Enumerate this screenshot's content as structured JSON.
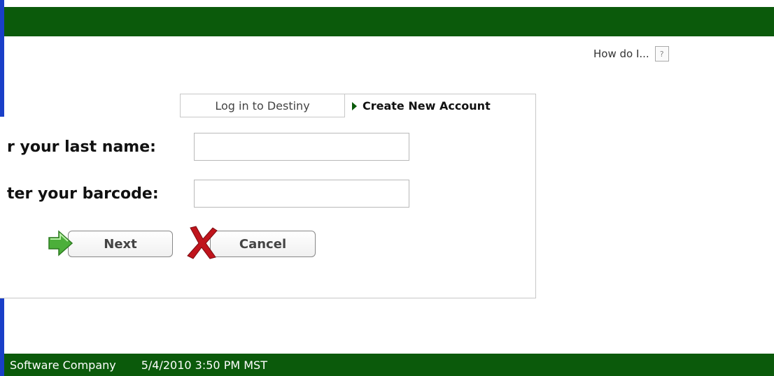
{
  "help": {
    "label": "How do I...",
    "icon_text": "?"
  },
  "tabs": [
    {
      "label": "Log in to Destiny",
      "active": false
    },
    {
      "label": "Create New Account",
      "active": true
    }
  ],
  "form": {
    "last_name_label": "r your last name:",
    "barcode_label": "ter your barcode:",
    "last_name_value": "",
    "barcode_value": ""
  },
  "buttons": {
    "next_label": "Next",
    "cancel_label": "Cancel"
  },
  "footer": {
    "company": "Software Company",
    "datetime": "5/4/2010 3:50 PM MST"
  },
  "colors": {
    "header_green": "#0b5a0b",
    "left_edge_blue": "#1a3fc8",
    "next_icon_green": "#4caf3a",
    "cancel_icon_red": "#c0141c"
  },
  "icons": {
    "help": "question-icon",
    "tab_active": "triangle-right-icon",
    "next": "arrow-right-icon",
    "cancel": "x-icon"
  }
}
